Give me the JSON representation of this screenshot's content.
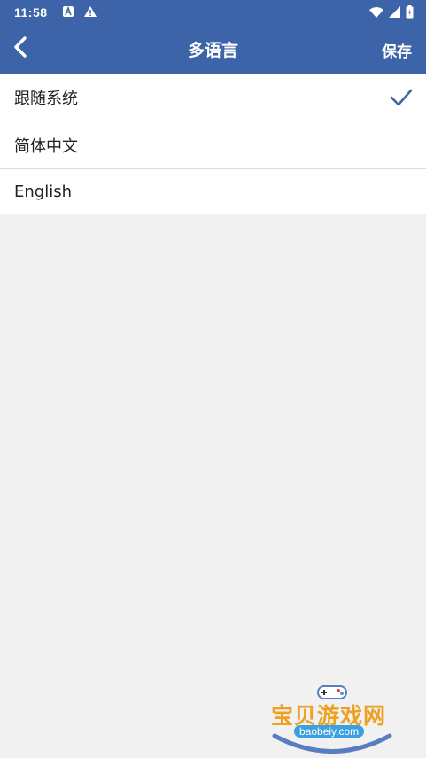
{
  "status_bar": {
    "time": "11:58",
    "left_icons": [
      "a-box-icon",
      "warning-icon"
    ],
    "right_icons": [
      "wifi-icon",
      "cell-signal-icon",
      "battery-icon"
    ]
  },
  "app_bar": {
    "title": "多语言",
    "save_label": "保存",
    "back_icon": "chevron-left-icon",
    "background_color": "#3d64a9"
  },
  "languages": {
    "items": [
      {
        "label": "跟随系统",
        "selected": true
      },
      {
        "label": "简体中文",
        "selected": false
      },
      {
        "label": "English",
        "selected": false
      }
    ],
    "check_icon": "checkmark-icon",
    "check_color": "#3d64a9"
  },
  "watermark": {
    "title": "宝贝游戏网",
    "url": "baobeiy.com"
  }
}
